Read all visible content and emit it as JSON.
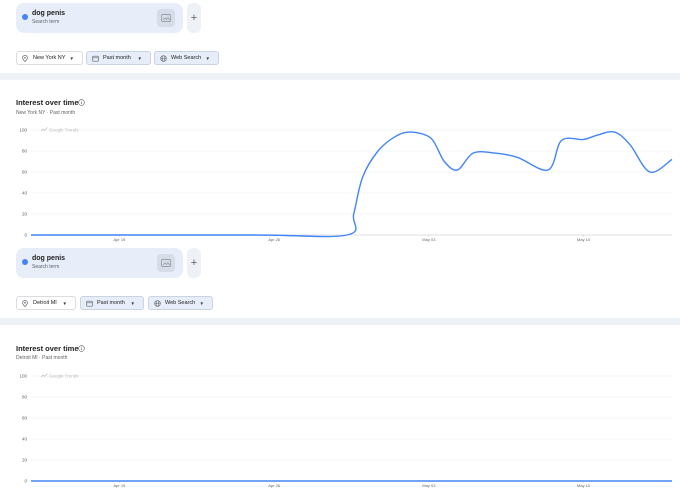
{
  "panels": [
    {
      "term": "dog penis",
      "term_sub": "Search term",
      "filters": {
        "location": "New York NY",
        "period": "Past month",
        "property": "Web Search"
      },
      "section_title": "Interest over time",
      "section_sub": "New York NY · Past month",
      "watermark": "Google Trends"
    },
    {
      "term": "dog penis",
      "term_sub": "Search term",
      "filters": {
        "location": "Detroit MI",
        "period": "Past month",
        "property": "Web Search"
      },
      "section_title": "Interest over time",
      "section_sub": "Detroit MI · Past month",
      "watermark": "Google Trends"
    }
  ],
  "add_label": "+",
  "series_color": "#4285f4",
  "icons": {
    "location": "location-pin-icon",
    "period": "calendar-icon",
    "property": "globe-icon",
    "compare": "compare-image-icon",
    "info": "info-icon",
    "watermark": "trending-up-icon"
  },
  "chart_data": [
    {
      "type": "line",
      "title": "",
      "y_ticks": [
        "100",
        "80",
        "60",
        "40",
        "20",
        "0"
      ],
      "ylim": [
        0,
        100
      ],
      "x_labels": [
        "Apr 19",
        "Apr 26",
        "May 03",
        "May 10"
      ],
      "x_label_days": [
        4,
        11,
        18,
        25
      ],
      "xlim": [
        0,
        29
      ],
      "grid": true,
      "series": [
        {
          "x": [
            0,
            10,
            14.3,
            14.6,
            15,
            15.7,
            16.5,
            17.2,
            18.1,
            18.7,
            19.3,
            20,
            21,
            22,
            23.4,
            24,
            25,
            25.6,
            26.4,
            27.1,
            28,
            29
          ],
          "values": [
            0,
            0,
            0,
            20,
            55,
            80,
            94,
            98,
            92,
            70,
            62,
            78,
            78,
            74,
            62,
            90,
            91,
            95,
            98,
            86,
            60,
            72
          ]
        }
      ]
    },
    {
      "type": "line",
      "title": "",
      "y_ticks": [
        "100",
        "80",
        "60",
        "40",
        "20",
        "0"
      ],
      "ylim": [
        0,
        100
      ],
      "x_labels": [
        "Apr 19",
        "Apr 26",
        "May 03",
        "May 10"
      ],
      "x_label_days": [
        4,
        11,
        18,
        25
      ],
      "xlim": [
        0,
        29
      ],
      "grid": true,
      "series": [
        {
          "x": [
            0,
            29
          ],
          "values": [
            0,
            0
          ]
        }
      ]
    }
  ]
}
